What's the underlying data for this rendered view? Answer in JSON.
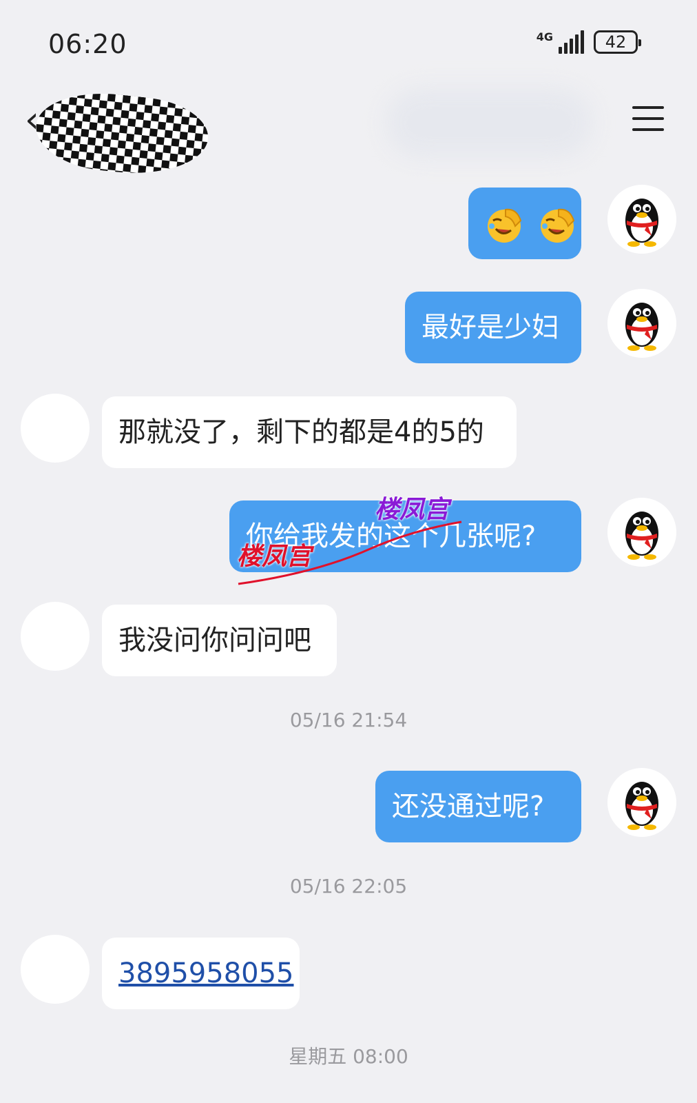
{
  "status_bar": {
    "time": "06:20",
    "network": "4G",
    "battery": "42"
  },
  "header": {
    "back_icon": "chevron-left-icon",
    "menu_icon": "hamburger-menu-icon"
  },
  "messages": [
    {
      "side": "out",
      "type": "emoji",
      "emoji": [
        "facepalm-laugh-emoji",
        "facepalm-laugh-emoji"
      ]
    },
    {
      "side": "out",
      "type": "text",
      "text": "最好是少妇"
    },
    {
      "side": "in",
      "type": "text",
      "text": "那就没了，剩下的都是4的5的"
    },
    {
      "side": "out",
      "type": "text",
      "text": "你给我发的这个几张呢?"
    },
    {
      "side": "in",
      "type": "text",
      "text": "我没问你问问吧"
    },
    {
      "type": "timestamp",
      "text": "05/16 21:54"
    },
    {
      "side": "out",
      "type": "text",
      "text": "还没通过呢?"
    },
    {
      "type": "timestamp",
      "text": "05/16 22:05"
    },
    {
      "side": "in",
      "type": "link",
      "text": "3895958055"
    },
    {
      "type": "timestamp",
      "text": "星期五 08:00"
    }
  ],
  "watermark": {
    "text_1": "楼凤宫",
    "text_2": "楼凤宫"
  },
  "colors": {
    "outgoing_bubble": "#4a9ff0",
    "incoming_bubble": "#ffffff",
    "background": "#f0f0f3",
    "link": "#1f4fa8"
  }
}
